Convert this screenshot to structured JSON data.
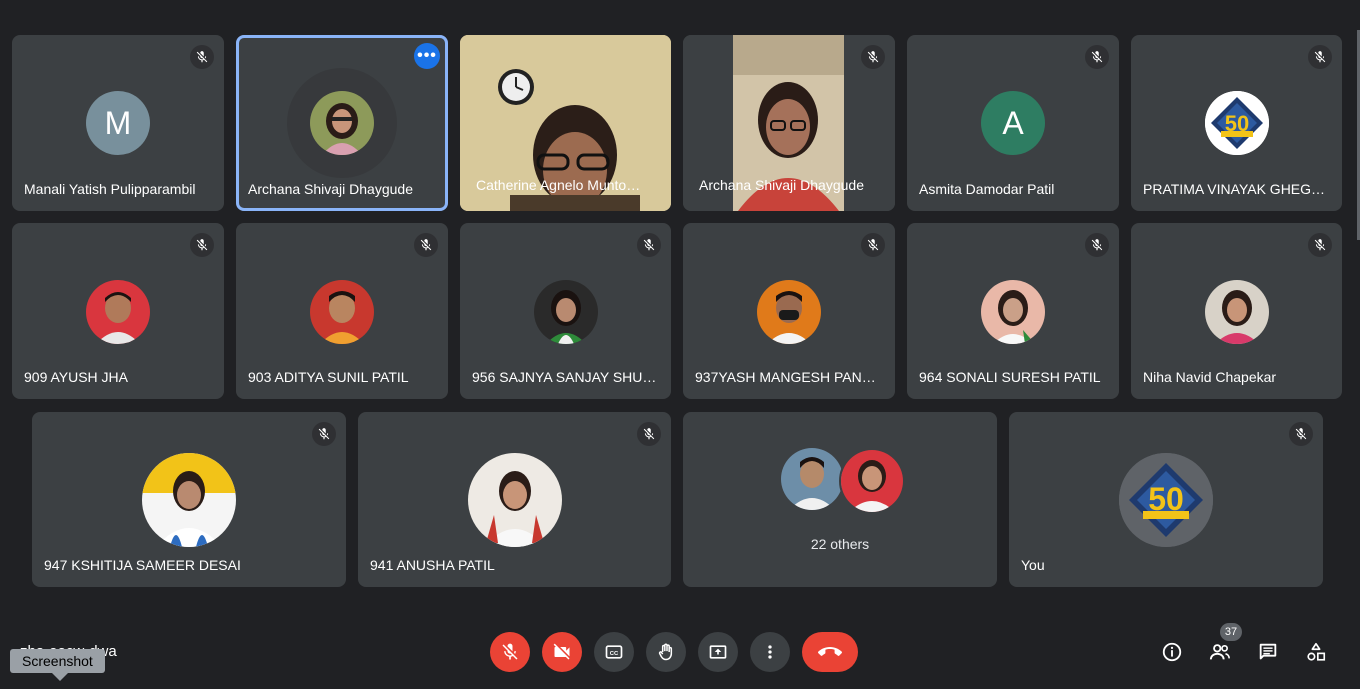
{
  "colors": {
    "background": "#202124",
    "tile": "#3c4043",
    "active_outline": "#8ab4f8",
    "red": "#ea4335",
    "avatar_m": "#78909c",
    "avatar_a": "#2e7d62"
  },
  "tiles": [
    {
      "name": "Manali Yatish Pulipparambil",
      "initial": "M"
    },
    {
      "name": "Archana Shivaji Dhaygude"
    },
    {
      "name": "Catherine Agnelo Munto…"
    },
    {
      "name": "Archana Shivaji Dhaygude"
    },
    {
      "name": "Asmita Damodar Patil",
      "initial": "A"
    },
    {
      "name": "PRATIMA VINAYAK GHEG…",
      "logo_text": "50"
    },
    {
      "name": "909 AYUSH JHA"
    },
    {
      "name": "903 ADITYA SUNIL PATIL"
    },
    {
      "name": "956 SAJNYA SANJAY SHU…"
    },
    {
      "name": "937YASH MANGESH PANG…"
    },
    {
      "name": "964 SONALI SURESH PATIL"
    },
    {
      "name": "Niha Navid Chapekar"
    },
    {
      "name": "947 KSHITIJA SAMEER DESAI"
    },
    {
      "name": "941 ANUSHA PATIL"
    },
    {
      "name": "22 others"
    },
    {
      "name": "You",
      "logo_text": "50"
    }
  ],
  "bottom": {
    "meeting_code": "zha-oocw-dwa",
    "tooltip": "Screenshot",
    "participants_count": "37"
  },
  "icons": {
    "mute": "mic-off-icon",
    "camera": "camera-off-icon",
    "captions": "captions-icon",
    "hand": "raise-hand-icon",
    "present": "present-screen-icon",
    "more": "more-vert-icon",
    "end": "call-end-icon",
    "info": "info-icon",
    "people": "people-icon",
    "chat": "chat-icon",
    "activities": "activities-icon"
  }
}
